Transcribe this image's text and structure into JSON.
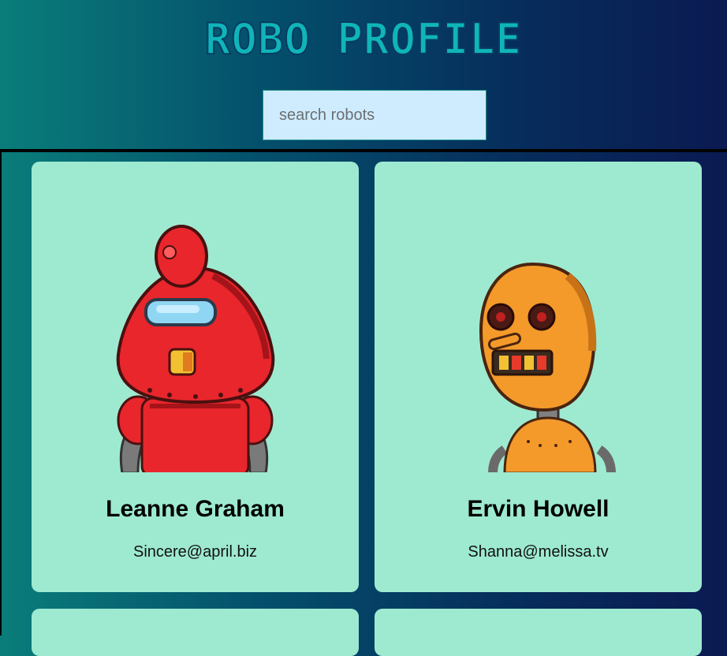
{
  "header": {
    "title": "Robo Profile",
    "search_placeholder": "search robots"
  },
  "robots": [
    {
      "name": "Leanne Graham",
      "email": "Sincere@april.biz",
      "avatar_icon": "red-robot-icon"
    },
    {
      "name": "Ervin Howell",
      "email": "Shanna@melissa.tv",
      "avatar_icon": "orange-robot-icon"
    },
    {
      "avatar_icon": "robot-icon"
    },
    {
      "avatar_icon": "robot-icon"
    }
  ],
  "colors": {
    "card_bg": "#9eead0",
    "title": "#0fb5b8",
    "search_bg": "#cfecff"
  }
}
